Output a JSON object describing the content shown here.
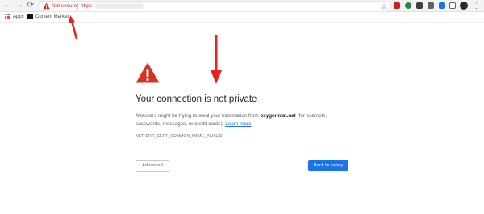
{
  "toolbar": {
    "back_icon": "back-arrow-icon",
    "forward_icon": "forward-arrow-icon",
    "reload_icon": "reload-icon",
    "security_label": "Not secure",
    "url_scheme": "https",
    "url_blurred": true
  },
  "bookmarks": {
    "apps_label": "Apps",
    "content_marketing_label": "Content Marketi"
  },
  "page": {
    "heading": "Your connection is not private",
    "desc_prefix": "Attackers might be trying to steal your information from ",
    "domain": "oxygenmat.net",
    "desc_suffix": " (for example, passwords, messages, or credit cards). ",
    "learn_more": "Learn more",
    "error_code": "NET::ERR_CERT_COMMON_NAME_INVALID",
    "advanced_button": "Advanced",
    "back_button": "Back to safety"
  },
  "colors": {
    "danger": "#d93025",
    "accent": "#1a73e8",
    "arrow": "#e8231e"
  }
}
